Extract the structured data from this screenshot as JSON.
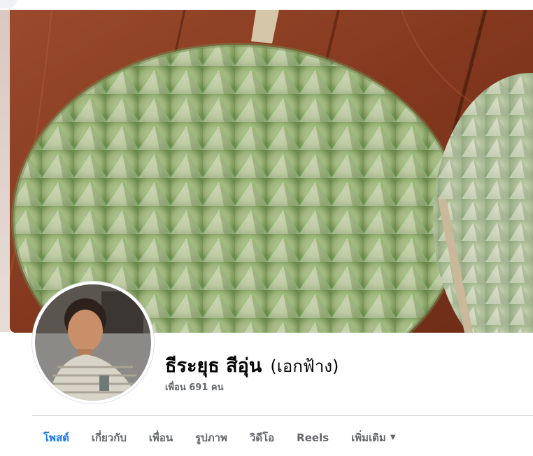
{
  "profile": {
    "name": "ธีระยุธ สีอุ่น",
    "alternate_name": "(เอกฟ้าง)",
    "friends": "เพื่อน 691 คน"
  },
  "tabs": [
    {
      "label": "โพสต์",
      "active": true
    },
    {
      "label": "เกี่ยวกับ",
      "active": false
    },
    {
      "label": "เพื่อน",
      "active": false
    },
    {
      "label": "รูปภาพ",
      "active": false
    },
    {
      "label": "วิดีโอ",
      "active": false
    },
    {
      "label": "Reels",
      "active": false
    },
    {
      "label": "เพิ่มเติม",
      "active": false
    }
  ],
  "colors": {
    "accent": "#1877f2",
    "muted_text": "#65676b",
    "divider": "#ced0d4"
  },
  "icons": {
    "more_dropdown": "caret-down-icon"
  }
}
